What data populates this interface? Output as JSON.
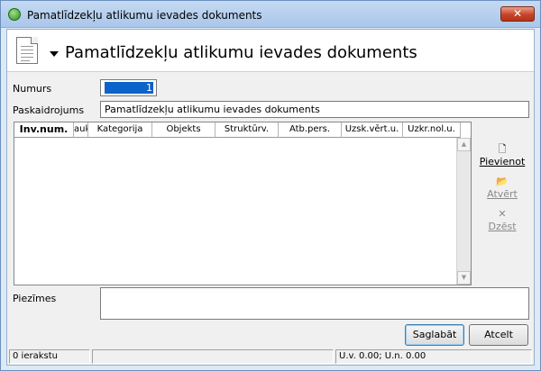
{
  "window": {
    "title": "Pamatlīdzekļu atlikumu ievades dokuments",
    "close_label": "✕"
  },
  "header": {
    "title": "Pamatlīdzekļu atlikumu ievades dokuments"
  },
  "form": {
    "numurs_label": "Numurs",
    "numurs_value": "1",
    "paskaidrojums_label": "Paskaidrojums",
    "paskaidrojums_value": "Pamatlīdzekļu atlikumu ievades dokuments",
    "piezimes_label": "Piezīmes",
    "piezimes_value": ""
  },
  "grid": {
    "columns": [
      "Inv.num.",
      "auk",
      "Kategorija",
      "Objekts",
      "Struktūrv.",
      "Atb.pers.",
      "Uzsk.vērt.u.",
      "Uzkr.nol.u."
    ],
    "rows": []
  },
  "actions": {
    "add": "Pievienot",
    "open": "Atvērt",
    "delete": "Dzēst",
    "save": "Saglabāt",
    "cancel": "Atcelt"
  },
  "status": {
    "records": "0 ierakstu",
    "middle": "",
    "totals": "U.v. 0.00; U.n. 0.00"
  },
  "colors": {
    "selection": "#0a63c9",
    "titlebar": "#aac6ea",
    "close_button": "#c7432a"
  }
}
